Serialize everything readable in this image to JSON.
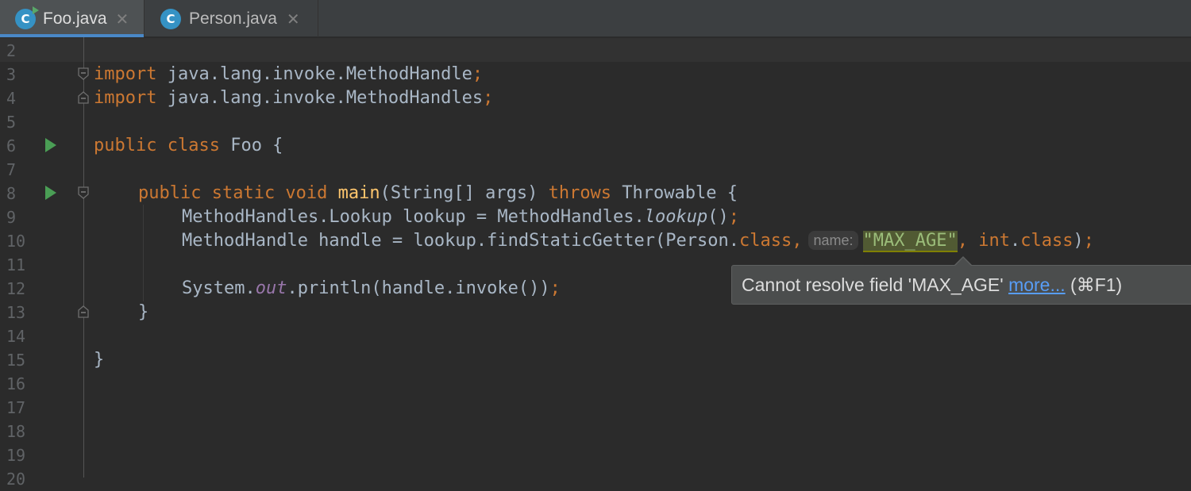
{
  "tabs": [
    {
      "label": "Foo.java",
      "icon": "class-icon",
      "active": true
    },
    {
      "label": "Person.java",
      "icon": "class-icon",
      "active": false
    }
  ],
  "tab_close_glyph": "✕",
  "class_icon_letter": "C",
  "line_numbers": [
    "2",
    "3",
    "4",
    "5",
    "6",
    "7",
    "8",
    "9",
    "10",
    "11",
    "12",
    "13",
    "14",
    "15",
    "16",
    "17",
    "18",
    "19",
    "20"
  ],
  "code": {
    "l3": {
      "kw": "import",
      "pkg": " java.lang.invoke.MethodHandle",
      "semi": ";"
    },
    "l4": {
      "kw": "import",
      "pkg": " java.lang.invoke.MethodHandles",
      "semi": ";"
    },
    "l6": {
      "kw": "public class",
      "name": " Foo {"
    },
    "l8": {
      "kw1": "public static void",
      "fn": " main",
      "args": "(String[] args) ",
      "kw2": "throws",
      "rest": " Throwable {"
    },
    "l9": {
      "pre": "MethodHandles.Lookup lookup = MethodHandles.",
      "it": "lookup",
      "post": "()",
      "semi": ";"
    },
    "l10": {
      "pre": "MethodHandle handle = lookup.findStaticGetter(Person.",
      "kw": "class",
      "comma": ",",
      "hint": "name:",
      "str": "\"MAX_AGE\"",
      "comma2": ", ",
      "kw2": "int",
      "dot": ".",
      "kw3": "class",
      "post": ")",
      "semi": ";"
    },
    "l12": {
      "pre": "System.",
      "fld": "out",
      "post": ".println(handle.invoke())",
      "semi": ";"
    },
    "l13": {
      "text": "}"
    },
    "l15": {
      "text": "}"
    }
  },
  "tooltip": {
    "message": "Cannot resolve field 'MAX_AGE' ",
    "link": "more...",
    "shortcut": " (⌘F1)"
  },
  "colors": {
    "background": "#2b2b2b",
    "keyword": "#cc7832",
    "method_decl": "#ffc66d",
    "static_field": "#9876aa",
    "string": "#6a8759",
    "link": "#589df6"
  }
}
